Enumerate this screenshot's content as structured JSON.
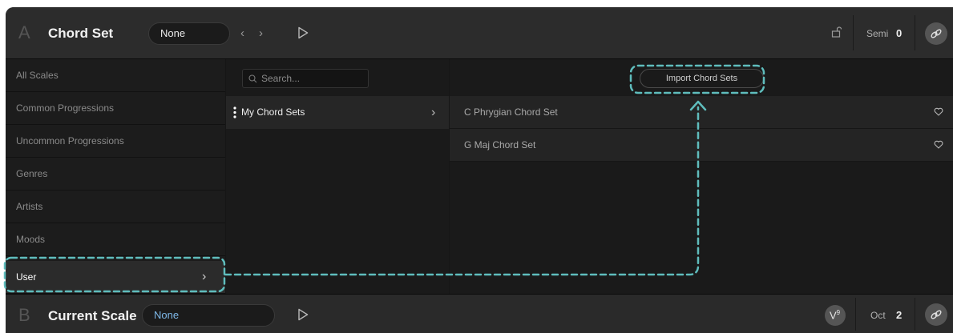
{
  "header": {
    "section_letter": "A",
    "title": "Chord Set",
    "selected": "None",
    "semi_label": "Semi",
    "semi_value": "0"
  },
  "sidebar": {
    "items": [
      {
        "label": "All Scales"
      },
      {
        "label": "Common Progressions"
      },
      {
        "label": "Uncommon Progressions"
      },
      {
        "label": "Genres"
      },
      {
        "label": "Artists"
      },
      {
        "label": "Moods"
      },
      {
        "label": "User"
      }
    ]
  },
  "middle": {
    "search_placeholder": "Search...",
    "folder": "My Chord Sets"
  },
  "right": {
    "import_label": "Import Chord Sets",
    "chord_sets": [
      "C Phrygian Chord Set",
      "G Maj Chord Set"
    ]
  },
  "footer": {
    "section_letter": "B",
    "title": "Current Scale",
    "selected": "None",
    "oct_label": "Oct",
    "oct_value": "2"
  },
  "colors": {
    "accent_dashed": "#5fbdbd",
    "scale_selected": "#7eb8e8"
  }
}
